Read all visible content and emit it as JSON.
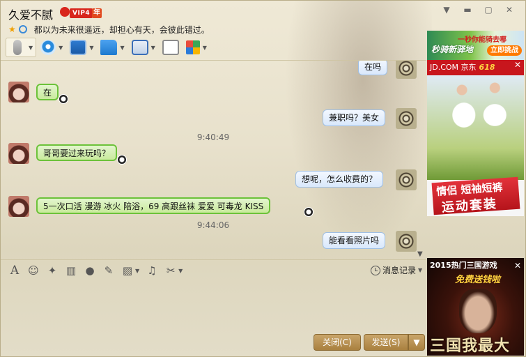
{
  "window": {
    "contact_name": "久爱不腻",
    "vip_label": "VIP4",
    "vip_year": "年",
    "signature": "都以为未来很遥远，却担心有天，会彼此错过。",
    "controls": {
      "dropdown": "▼",
      "minimize": "▬",
      "maximize": "▢",
      "close": "✕"
    }
  },
  "toolbar": {
    "items": [
      {
        "name": "voice",
        "icon": "microphone-icon"
      },
      {
        "name": "video",
        "icon": "camera-icon"
      },
      {
        "name": "remote",
        "icon": "screen-icon"
      },
      {
        "name": "file",
        "icon": "folder-icon"
      },
      {
        "name": "screen-share",
        "icon": "monitor-icon"
      },
      {
        "name": "note",
        "icon": "note-add-icon"
      },
      {
        "name": "apps",
        "icon": "apps-grid-icon"
      }
    ]
  },
  "messages": [
    {
      "from": "me",
      "text": "在吗"
    },
    {
      "from": "her",
      "text": "在"
    },
    {
      "from": "me",
      "text": "兼职吗？美女"
    },
    {
      "timestamp": "9:40:49"
    },
    {
      "from": "her",
      "text": "哥哥要过来玩吗？"
    },
    {
      "from": "me",
      "text": "想呢，怎么收费的？"
    },
    {
      "from": "her",
      "text": "5一次口活  漫游  冰火  陪浴，69   高跟丝袜  爱爱  可毒龙  KISS"
    },
    {
      "timestamp": "9:44:06"
    },
    {
      "from": "me",
      "text": "能看看照片吗"
    }
  ],
  "input_toolbar": {
    "font": "A",
    "emoji": "☺",
    "history_label": "消息记录"
  },
  "buttons": {
    "close": "关闭(C)",
    "send": "发送(S)",
    "send_options": "▼"
  },
  "ads": {
    "ad1": {
      "title": "一秒你能骑去哪",
      "logo": "秒骑新驿地",
      "cta": "立即挑战"
    },
    "ad2": {
      "brand": "JD.COM 京东",
      "promo": "618",
      "line1": "情侣 短袖短裤",
      "line2": "运动套装"
    },
    "ad3": {
      "head": "2015热门三国游戏",
      "sub": "免费送钱啦",
      "bottom": "三国我最大"
    }
  },
  "colors": {
    "bubble_in_border": "#6cc23a",
    "bubble_out_border": "#9fbfe4",
    "button_gold": "#b8904f",
    "vip_red": "#d8261c"
  }
}
